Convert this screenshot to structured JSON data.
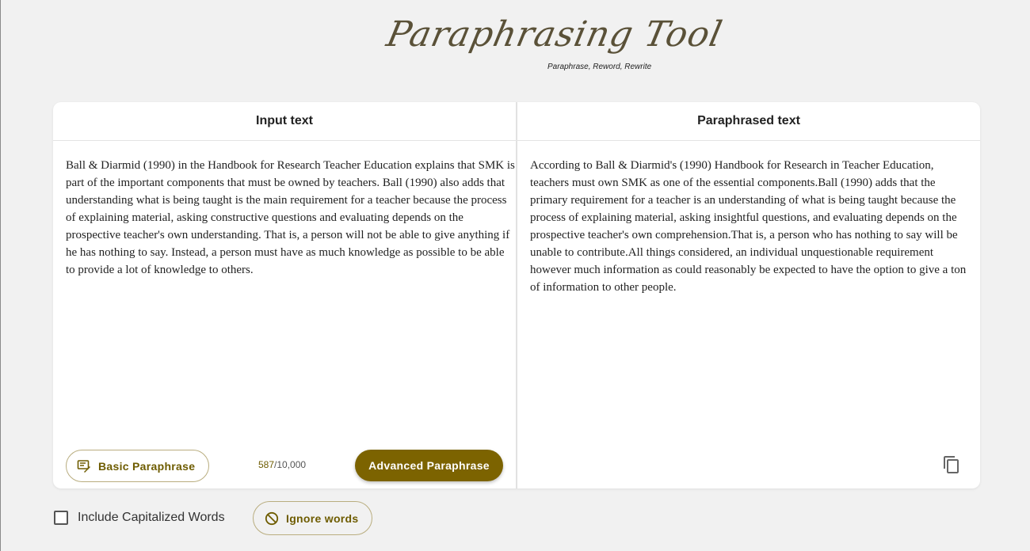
{
  "logo": {
    "title": "Paraphrasing Tool",
    "tagline": "Paraphrase, Reword, Rewrite"
  },
  "input_panel": {
    "title": "Input text",
    "text": "Ball & Diarmid (1990) in the Handbook for Research Teacher Education explains that SMK is part of the important components that must be owned by teachers. Ball (1990) also adds that understanding what is being taught is the main requirement for a teacher because the process of explaining material, asking constructive questions and evaluating depends on the prospective teacher's own understanding. That is, a person will not be able to give anything if he has nothing to say. Instead, a person must have as much knowledge as possible to be able to provide a lot of knowledge to others.",
    "basic_button": "Basic Paraphrase",
    "char_count": "587",
    "char_limit": "/10,000",
    "advanced_button": "Advanced Paraphrase"
  },
  "output_panel": {
    "title": "Paraphrased text",
    "text": "According to Ball & Diarmid's (1990) Handbook for Research in Teacher Education, teachers must own SMK as one of the essential components.Ball (1990) adds that the primary requirement for a teacher is an understanding of what is being taught because the process of explaining material, asking insightful questions, and evaluating depends on the prospective teacher's own comprehension.That is, a person who has nothing to say will be unable to contribute.All things considered, an individual unquestionable requirement however much information as could reasonably be expected to have the option to give a ton of information to other people.",
    "copy_icon": "copy-icon"
  },
  "options": {
    "include_capitalized_label": "Include Capitalized Words",
    "include_capitalized_checked": false,
    "ignore_words_button": "Ignore words"
  },
  "colors": {
    "accent": "#7c6300",
    "accent_text": "#6e5c00",
    "background": "#f1f1f1"
  }
}
